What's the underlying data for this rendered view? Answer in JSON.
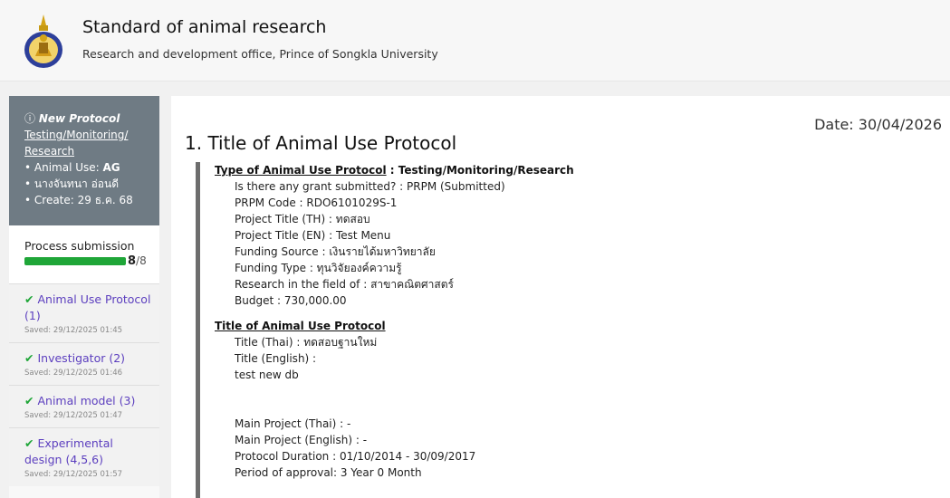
{
  "header": {
    "title": "Standard of animal research",
    "subtitle": "Research and development office, Prince of Songkla University"
  },
  "sidebar": {
    "protocol_status": "New Protocol",
    "protocol_type": "Testing/Monitoring/ Research",
    "animal_use_label": "• Animal Use: ",
    "animal_use_value": "AG",
    "owner": "• นางจันทนา อ่อนดี",
    "created": "• Create: 29 ธ.ค. 68",
    "progress_label": "Process submission",
    "progress_done": "8",
    "progress_total": "/8",
    "progress_fraction": 1.0,
    "steps": [
      {
        "label": "Animal Use Protocol (1)",
        "saved": "Saved: 29/12/2025 01:45"
      },
      {
        "label": "Investigator (2)",
        "saved": "Saved: 29/12/2025 01:46"
      },
      {
        "label": "Animal model (3)",
        "saved": "Saved: 29/12/2025 01:47"
      },
      {
        "label": "Experimental design (4,5,6)",
        "saved": "Saved: 29/12/2025 01:57"
      }
    ]
  },
  "main": {
    "date": "Date: 30/04/2026",
    "title": "1. Title of Animal Use Protocol",
    "type_heading": "Type of Animal Use Protocol",
    "type_value": " : Testing/Monitoring/Research",
    "grant": "Is there any grant submitted? : PRPM (Submitted)",
    "prpm_code": "PRPM Code : RDO6101029S-1",
    "project_th": "Project Title (TH) : ทดสอบ",
    "project_en": "Project Title (EN) : Test Menu",
    "funding_source": "Funding Source : เงินรายได้มหาวิทยาลัย",
    "funding_type": "Funding Type : ทุนวิจัยองค์ความรู้",
    "research_field": "Research in the field of : สาขาคณิตศาสตร์",
    "budget": "Budget : 730,000.00",
    "title_heading": "Title of Animal Use Protocol",
    "title_thai": "Title (Thai) : ทดสอบฐานใหม่",
    "title_english": "Title (English) :",
    "title_english_value": "test new db",
    "main_project_thai": "Main Project (Thai) : -",
    "main_project_english": "Main Project (English) : -",
    "protocol_duration": "Protocol Duration : 01/10/2014 - 30/09/2017",
    "period_approval": "Period of approval: 3 Year 0 Month"
  }
}
